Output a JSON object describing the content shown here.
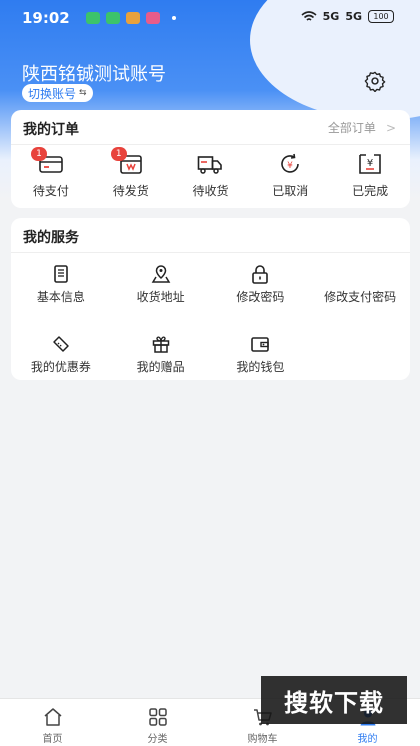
{
  "status_bar": {
    "time": "19:02",
    "signal1": "5G",
    "signal2": "5G",
    "battery": "100"
  },
  "header": {
    "account_name": "陕西铭铖测试账号",
    "switch_label": "切换账号",
    "switch_arrow": "⇆"
  },
  "orders": {
    "title": "我的订单",
    "all_label": "全部订单",
    "items": [
      {
        "label": "待支付",
        "badge": "1",
        "icon": "card-icon"
      },
      {
        "label": "待发货",
        "badge": "1",
        "icon": "package-icon"
      },
      {
        "label": "待收货",
        "badge": "",
        "icon": "truck-icon"
      },
      {
        "label": "已取消",
        "badge": "",
        "icon": "refund-icon"
      },
      {
        "label": "已完成",
        "badge": "",
        "icon": "receipt-icon"
      }
    ]
  },
  "services": {
    "title": "我的服务",
    "items": [
      {
        "label": "基本信息",
        "icon": "document-icon"
      },
      {
        "label": "收货地址",
        "icon": "map-pin-icon"
      },
      {
        "label": "修改密码",
        "icon": "lock-icon"
      },
      {
        "label": "修改支付密码",
        "icon": "lock-icon"
      },
      {
        "label": "我的优惠券",
        "icon": "coupon-icon"
      },
      {
        "label": "我的赠品",
        "icon": "gift-icon"
      },
      {
        "label": "我的钱包",
        "icon": "wallet-icon"
      }
    ]
  },
  "tabbar": [
    {
      "label": "首页",
      "active": false
    },
    {
      "label": "分类",
      "active": false
    },
    {
      "label": "购物车",
      "active": false
    },
    {
      "label": "我的",
      "active": true
    }
  ],
  "watermark": "搜软下载",
  "colors": {
    "primary": "#2f7cf0",
    "badge": "#e8433c",
    "icon_red": "#e8433c"
  }
}
